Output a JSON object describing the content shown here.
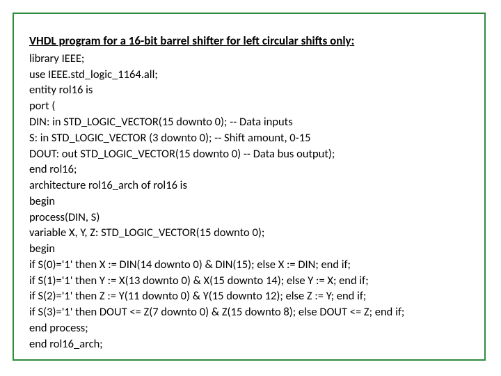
{
  "title": "VHDL program for a 16-bit barrel shifter for left circular shifts only:",
  "lines": [
    "library IEEE;",
    "use IEEE.std_logic_1164.all;",
    "entity rol16 is",
    "port (",
    "DIN: in STD_LOGIC_VECTOR(15 downto 0); -- Data inputs",
    "S: in STD_LOGIC_VECTOR (3 downto 0); -- Shift amount, 0-15",
    "DOUT: out STD_LOGIC_VECTOR(15 downto 0) -- Data bus output);",
    "end rol16;",
    "architecture rol16_arch of rol16 is",
    "begin",
    "process(DIN, S)",
    "variable X, Y, Z: STD_LOGIC_VECTOR(15 downto 0);",
    "begin",
    "if S(0)='1' then X := DIN(14 downto 0) & DIN(15); else X := DIN; end if;",
    "if S(1)='1' then Y := X(13 downto 0) & X(15 downto 14); else Y := X; end if;",
    "if S(2)='1' then Z := Y(11 downto 0) & Y(15 downto 12); else Z := Y; end if;",
    "if S(3)='1' then DOUT <= Z(7 downto 0) & Z(15 downto 8); else DOUT <= Z; end if;",
    "end process;",
    "end rol16_arch;"
  ]
}
